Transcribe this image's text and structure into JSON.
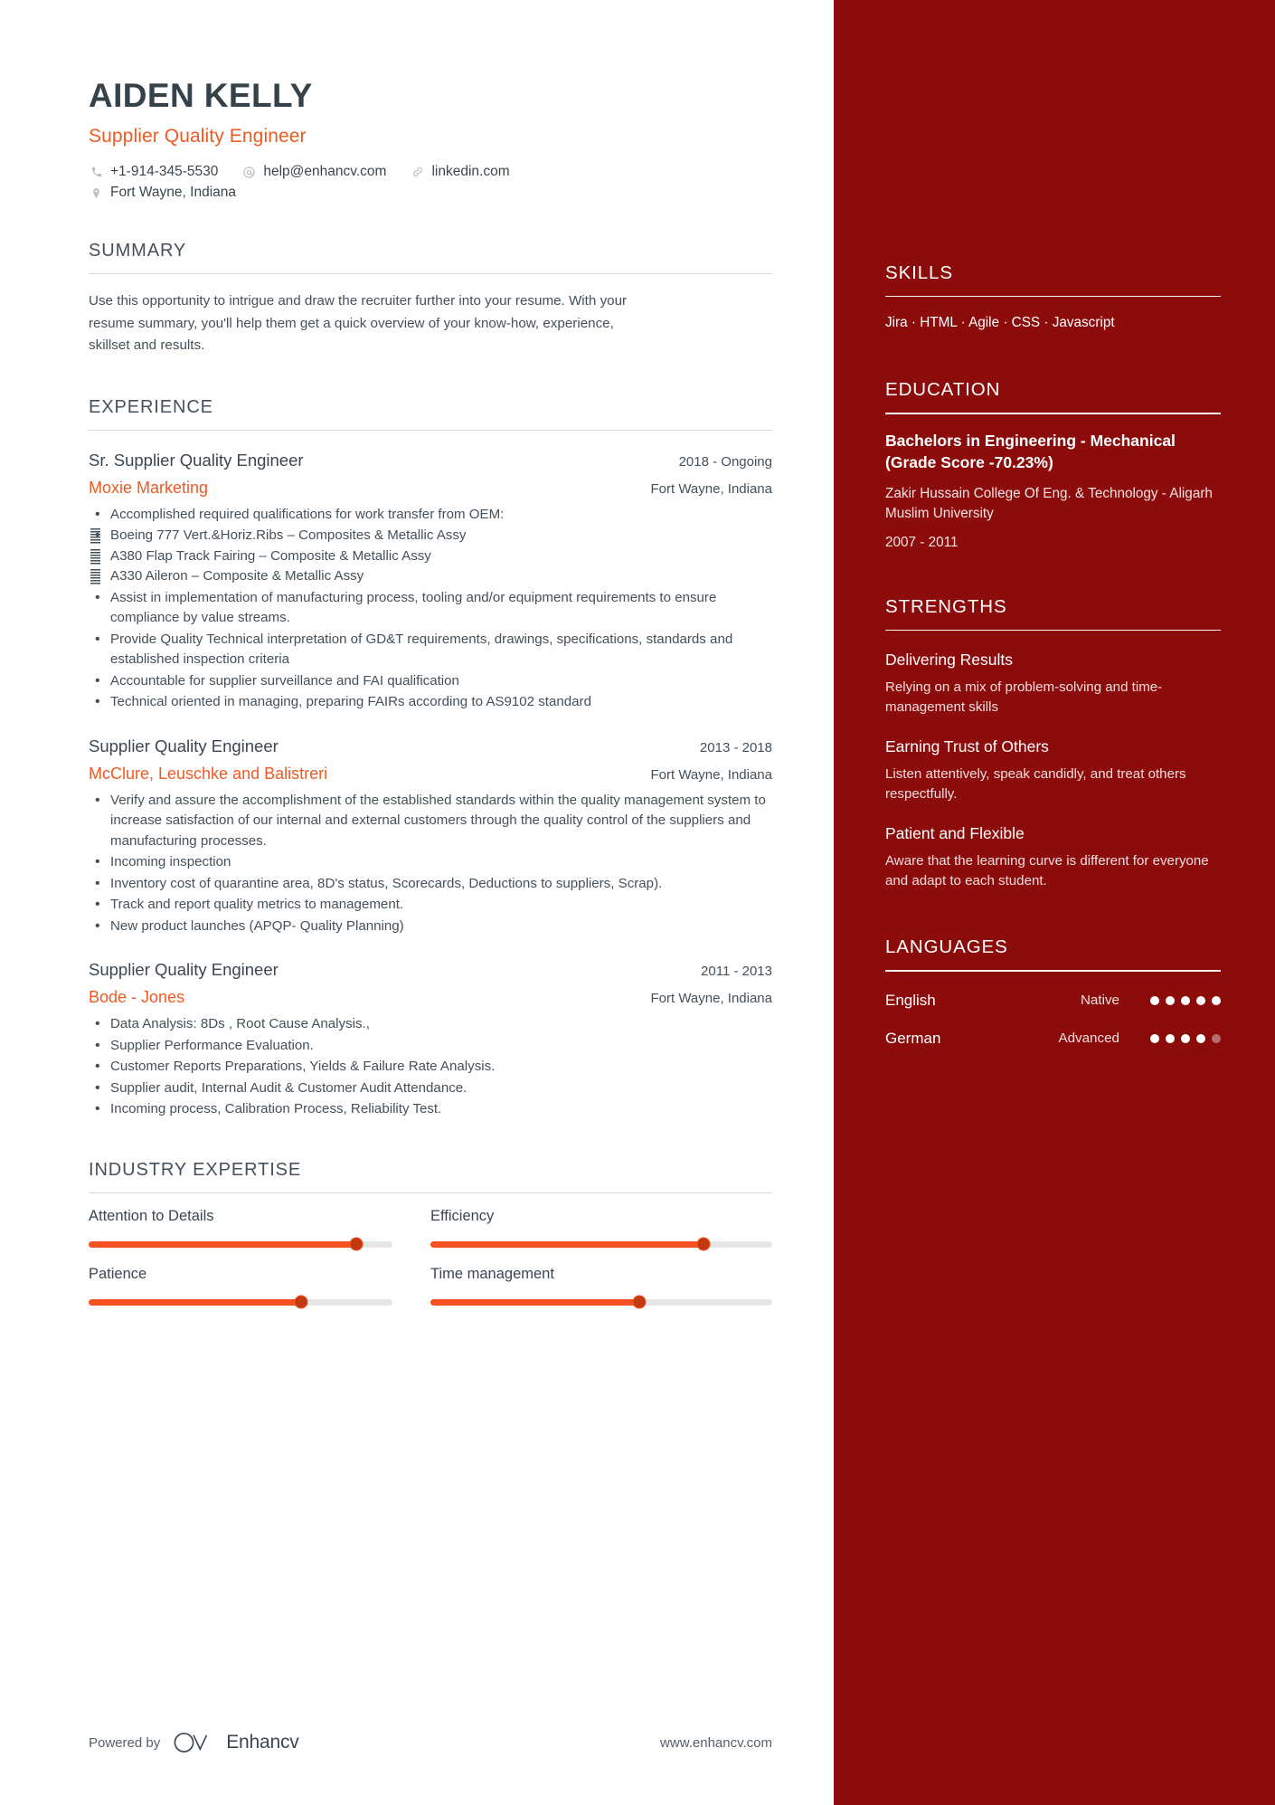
{
  "header": {
    "name": "AIDEN KELLY",
    "job_title": "Supplier Quality Engineer",
    "contacts": [
      {
        "icon": "phone-icon",
        "text": "+1-914-345-5530"
      },
      {
        "icon": "email-icon",
        "text": "help@enhancv.com"
      },
      {
        "icon": "link-icon",
        "text": "linkedin.com"
      }
    ],
    "location": {
      "icon": "location-pin-icon",
      "text": "Fort Wayne, Indiana"
    }
  },
  "summary": {
    "title": "SUMMARY",
    "text": "Use this opportunity to intrigue and draw the recruiter further into your resume. With your resume summary, you'll help them get a quick overview of your know-how, experience, skillset and results."
  },
  "experience": {
    "title": "EXPERIENCE",
    "jobs": [
      {
        "role": "Sr. Supplier Quality Engineer",
        "dates": "2018 - Ongoing",
        "company": "Moxie Marketing",
        "location": "Fort Wayne, Indiana",
        "bullets": [
          "Accomplished required qualifications for work transfer from OEM:",
          "Assist in implementation of manufacturing process, tooling and/or equipment requirements to ensure compliance by value streams.",
          "Provide Quality Technical interpretation of GD&T requirements, drawings, specifications, standards and established inspection criteria",
          "Accountable for supplier surveillance and FAI qualification",
          "Technical oriented in managing, preparing FAIRs according to AS9102 standard"
        ],
        "subbullets": [
          "Boeing 777 Vert.&Horiz.Ribs – Composites & Metallic Assy",
          "A380 Flap Track Fairing – Composite & Metallic Assy",
          "A330 Aileron – Composite & Metallic Assy"
        ]
      },
      {
        "role": "Supplier Quality Engineer",
        "dates": "2013 - 2018",
        "company": "McClure, Leuschke and Balistreri",
        "location": "Fort Wayne, Indiana",
        "bullets": [
          "Verify and assure the accomplishment of the established standards within the quality management system to increase satisfaction of our internal and external customers through the quality control of  the suppliers and manufacturing processes.",
          " Incoming inspection",
          "Inventory cost of quarantine area, 8D's status, Scorecards, Deductions to suppliers, Scrap).",
          "Track and report quality metrics to management.",
          "New product launches (APQP- Quality Planning)"
        ],
        "subbullets": []
      },
      {
        "role": "Supplier Quality Engineer",
        "dates": "2011 - 2013",
        "company": "Bode - Jones",
        "location": "Fort Wayne, Indiana",
        "bullets": [
          "Data Analysis: 8Ds , Root Cause Analysis.,",
          "Supplier Performance Evaluation.",
          "Customer Reports Preparations, Yields & Failure Rate Analysis.",
          "Supplier audit, Internal Audit & Customer Audit Attendance.",
          "Incoming process, Calibration Process, Reliability Test."
        ],
        "subbullets": []
      }
    ]
  },
  "industry_expertise": {
    "title": "INDUSTRY EXPERTISE",
    "items": [
      {
        "label": "Attention to Details",
        "percent": 88
      },
      {
        "label": "Efficiency",
        "percent": 80
      },
      {
        "label": "Patience",
        "percent": 70
      },
      {
        "label": "Time management",
        "percent": 61
      }
    ]
  },
  "footer": {
    "powered_by": "Powered by",
    "brand": "Enhancv",
    "website": "www.enhancv.com"
  },
  "sidebar": {
    "skills": {
      "title": "SKILLS",
      "list": "Jira · HTML · Agile · CSS · Javascript"
    },
    "education": {
      "title": "EDUCATION",
      "degree": "Bachelors in Engineering - Mechanical (Grade Score -70.23%)",
      "school": "Zakir Hussain College Of Eng. & Technology - Aligarh Muslim University",
      "years": "2007 - 2011"
    },
    "strengths": {
      "title": "STRENGTHS",
      "items": [
        {
          "title": "Delivering Results",
          "desc": "Relying on a mix of problem-solving and time-management skills"
        },
        {
          "title": "Earning Trust of Others",
          "desc": "Listen attentively, speak candidly, and treat others respectfully."
        },
        {
          "title": "Patient and Flexible",
          "desc": "Aware that the learning curve is different for everyone and adapt to each student."
        }
      ]
    },
    "languages": {
      "title": "LANGUAGES",
      "items": [
        {
          "name": "English",
          "level": "Native",
          "filled": 5,
          "total": 5
        },
        {
          "name": "German",
          "level": "Advanced",
          "filled": 4,
          "total": 5
        }
      ]
    }
  },
  "colors": {
    "accent_orange": "#f05a22",
    "sidebar_red": "#8c0b0b",
    "heading_gray": "#46505a",
    "slider_fill": "#f4511e",
    "slider_knob": "#c43a10"
  }
}
